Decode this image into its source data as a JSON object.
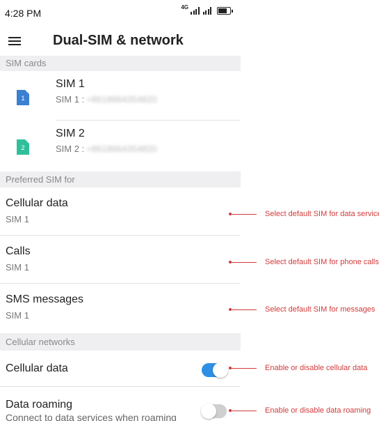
{
  "status_bar": {
    "time": "4:28 PM",
    "network_type": "4G"
  },
  "header": {
    "title": "Dual-SIM & network"
  },
  "sections": {
    "sim_cards": "SIM cards",
    "preferred": "Preferred SIM for",
    "cellular_networks": "Cellular networks"
  },
  "sims": [
    {
      "badge": "1",
      "name": "SIM 1",
      "label": "SIM 1 :",
      "number": "+8618664354820",
      "color": "#3b80d1"
    },
    {
      "badge": "2",
      "name": "SIM 2",
      "label": "SIM 2 :",
      "number": "+8618664354820",
      "color": "#2fc09a"
    }
  ],
  "preferred": [
    {
      "title": "Cellular data",
      "value": "SIM 1"
    },
    {
      "title": "Calls",
      "value": "SIM 1"
    },
    {
      "title": "SMS messages",
      "value": "SIM 1"
    }
  ],
  "network": {
    "cellular_data": {
      "title": "Cellular data",
      "enabled": true
    },
    "roaming": {
      "title": "Data roaming",
      "subtitle": "Connect to data services when roaming",
      "enabled": false
    }
  },
  "annotations": {
    "data_services": "Select default SIM for data services",
    "phone_calls": "Select default SIM for phone calls",
    "messages": "Select default SIM for messages",
    "cellular_toggle": "Enable or disable cellular data",
    "roaming_toggle": "Enable or disable data roaming"
  },
  "colors": {
    "accent": "#2e8fe4",
    "annotation": "#d23a3a",
    "section_bg": "#efeff1"
  }
}
